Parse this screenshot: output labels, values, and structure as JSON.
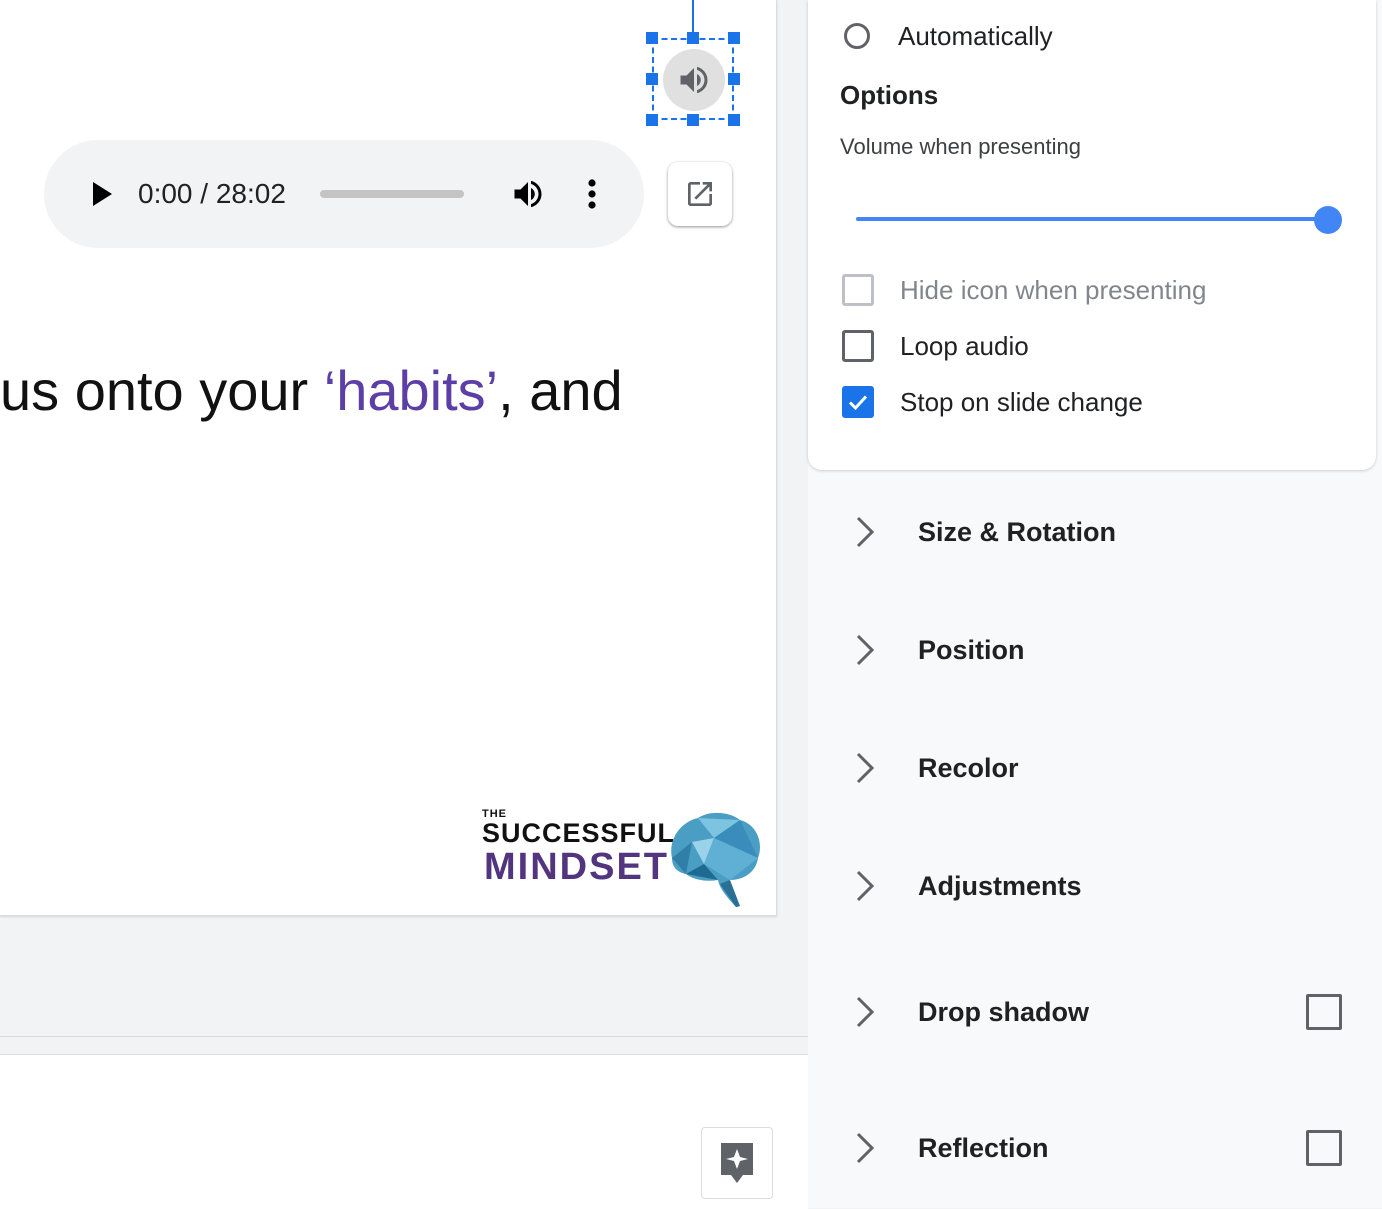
{
  "player": {
    "time": "0:00 / 28:02"
  },
  "slide": {
    "text_before": "us onto your ",
    "text_highlight": "‘habits’",
    "text_after": ", and",
    "logo": {
      "the": "THE",
      "line1": "SUCCESSFUL",
      "line2": "MINDSET"
    }
  },
  "panel": {
    "start_option": "Automatically",
    "options_title": "Options",
    "volume_label": "Volume when presenting",
    "volume_level": 1.0,
    "checkboxes": [
      {
        "label": "Hide icon when presenting",
        "checked": false,
        "disabled": true
      },
      {
        "label": "Loop audio",
        "checked": false,
        "disabled": false
      },
      {
        "label": "Stop on slide change",
        "checked": true,
        "disabled": false
      }
    ],
    "sections": [
      {
        "label": "Size & Rotation"
      },
      {
        "label": "Position"
      },
      {
        "label": "Recolor"
      },
      {
        "label": "Adjustments"
      },
      {
        "label": "Drop shadow",
        "checkbox": false
      },
      {
        "label": "Reflection",
        "checkbox": false
      }
    ]
  },
  "colors": {
    "accent": "#1a73e8",
    "slider": "#4285f4",
    "highlight_text": "#5b3ea6",
    "logo_purple": "#52347f"
  },
  "icons": [
    "speaker-icon",
    "play-icon",
    "volume-icon",
    "more-vert-icon",
    "open-in-new-icon",
    "brain-logo-icon",
    "explore-icon",
    "check-icon",
    "chevron-right-icon"
  ]
}
